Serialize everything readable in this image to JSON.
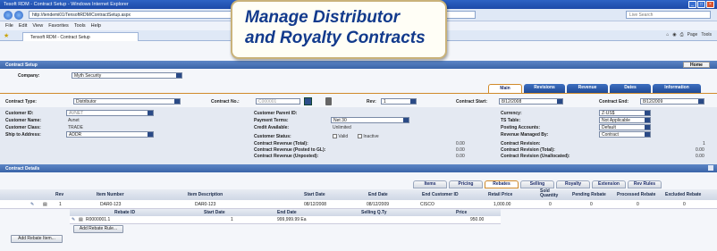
{
  "browser": {
    "title": "Tesoft RDM - Contract Setup - Windows Internet Explorer",
    "address": "http://tendemi01/TensoftRDM/ContractSetup.aspx",
    "search_placeholder": "Live Search",
    "menu": [
      "File",
      "Edit",
      "View",
      "Favorites",
      "Tools",
      "Help"
    ],
    "tab_label": "Tensoft RDM - Contract Setup",
    "toolbar": [
      "Page",
      "Tools"
    ]
  },
  "callout": {
    "line1": "Manage Distributor",
    "line2": "and Royalty Contracts"
  },
  "setup": {
    "section_title": "Contract Setup",
    "home_label": "Home",
    "company_label": "Company:",
    "company_value": "Myth Security",
    "tabs": [
      "Main",
      "Revisions",
      "Revenue",
      "Dates",
      "Information"
    ],
    "active_tab": "Main",
    "contract_type_label": "Contract Type:",
    "contract_type_value": "Distributor",
    "contract_no_label": "Contract No.:",
    "contract_no_value": "C000001",
    "rev_label": "Rev:",
    "rev_value": "1",
    "contract_start_label": "Contract Start:",
    "contract_start_value": "8/12/2008",
    "contract_end_label": "Contract End:",
    "contract_end_value": "8/12/2009"
  },
  "left_fields": [
    {
      "label": "Customer ID:",
      "value": "AVNET",
      "type": "select"
    },
    {
      "label": "Customer Name:",
      "value": "Avnet",
      "type": "text"
    },
    {
      "label": "Customer Class:",
      "value": "TRADE",
      "type": "text"
    },
    {
      "label": "Ship to Address:",
      "value": "ADDR",
      "type": "select"
    }
  ],
  "mid_fields": [
    {
      "label": "Customer Parent ID:",
      "value": ""
    },
    {
      "label": "Payment Terms:",
      "value": "Net 30"
    },
    {
      "label": "Credit Available:",
      "value": "Unlimited"
    },
    {
      "label": "Customer Status:",
      "value": ""
    }
  ],
  "status_checks": [
    "Valid",
    "Inactive"
  ],
  "revenue_fields": [
    {
      "label": "Contract Revenue (Total):",
      "value": "0.00"
    },
    {
      "label": "Contract Revenue (Posted to GL):",
      "value": "0.00"
    },
    {
      "label": "Contract Revenue (Unposted):",
      "value": "0.00"
    }
  ],
  "right_fields": [
    {
      "label": "Currency:",
      "value": "Z-US$"
    },
    {
      "label": "TS Table:",
      "value": "Not Applicable"
    },
    {
      "label": "Posting Accounts:",
      "value": "Default"
    },
    {
      "label": "Revenue Managed By:",
      "value": "Contract"
    },
    {
      "label": "Contract Revision:",
      "value": "1"
    },
    {
      "label": "Contract Revision (Total):",
      "value": "0.00"
    },
    {
      "label": "Contract Revision (Unallocated):",
      "value": "0.00"
    }
  ],
  "details": {
    "section_title": "Contract Details",
    "subtabs": [
      "Items",
      "Pricing",
      "Rebates",
      "Selling",
      "Royalty",
      "Extension",
      "Rev Rules"
    ],
    "active_subtab": "Rebates",
    "columns": [
      "Rev",
      "Item Number",
      "Item Description",
      "Start Date",
      "End Date",
      "End Customer ID",
      "Retail Price",
      "Sold Quantity",
      "Pending Rebate",
      "Processed Rebate",
      "Excluded Rebate"
    ],
    "row": [
      "1",
      "DAR0-123",
      "DAR0-123",
      "08/12/2008",
      "08/12/2009",
      "CISCO",
      "1,000.00",
      "0",
      "0",
      "0",
      "0"
    ],
    "sub_columns": [
      "Rebate ID",
      "Start Date",
      "End Date",
      "Selling Q.Ty",
      "Price"
    ],
    "sub_row": [
      "R0000001.1",
      "1",
      "999,999.99 Ea",
      "950.00"
    ],
    "add_rebate_rule": "Add Rebate Rule...",
    "add_rebate_item": "Add Rebate Item..."
  }
}
